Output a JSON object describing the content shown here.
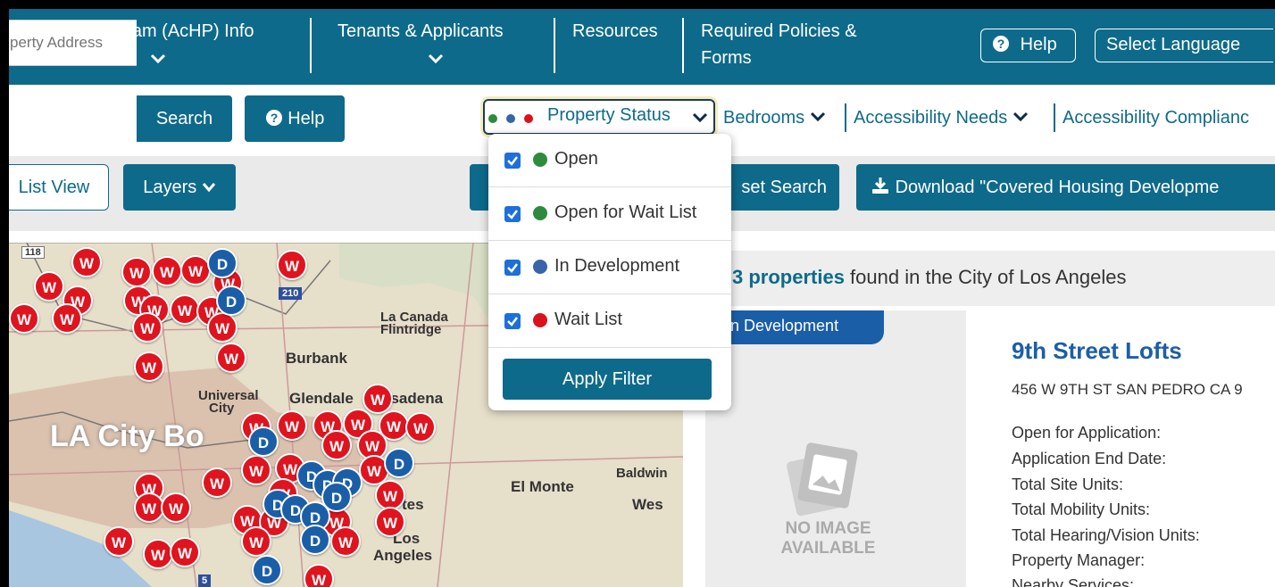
{
  "nav": {
    "items": [
      {
        "label": "Housing Program (AcHP) Info"
      },
      {
        "label": "Tenants & Applicants"
      },
      {
        "label": "Resources"
      },
      {
        "label": "Required Policies &"
      },
      {
        "label": "Forms"
      }
    ],
    "help_label": "Help",
    "language_label": "Select Language"
  },
  "search": {
    "placeholder": "perty Address",
    "search_label": "Search",
    "help_label": "Help"
  },
  "filters": {
    "property_status": "Property Status",
    "bedrooms": "Bedrooms",
    "accessibility_needs": "Accessibility Needs",
    "accessibility_compliance": "Accessibility Complianc"
  },
  "toolbar": {
    "list_view": "List View",
    "layers": "Layers",
    "reset_search": "set Search",
    "download": "Download \"Covered Housing Developme"
  },
  "dropdown": {
    "options": [
      {
        "label": "Open",
        "color": "#2e8b3e",
        "checked": true
      },
      {
        "label": "Open for Wait List",
        "color": "#2e8b3e",
        "checked": true
      },
      {
        "label": "In Development",
        "color": "#3a64a8",
        "checked": true
      },
      {
        "label": "Wait List",
        "color": "#d8121e",
        "checked": true
      }
    ],
    "apply_label": "Apply Filter"
  },
  "map": {
    "labels": {
      "la_canada": "La Canada",
      "flintridge": "Flintridge",
      "burbank": "Burbank",
      "universal": "Universal",
      "city": "City",
      "glendale": "Glendale",
      "pasadena": "asadena",
      "la_city_bo": "LA City Bo",
      "el_monte": "El Monte",
      "baldwin": "Baldwin",
      "west": "Wes",
      "los": "Los",
      "angeles": "Angeles",
      "tes": "tes",
      "hwy_118": "118",
      "hwy_210": "210",
      "hwy_5": "5"
    },
    "marker_w": "W",
    "marker_d": "D"
  },
  "results": {
    "count_bold": "3 properties",
    "count_rest": " found in the City of Los Angeles"
  },
  "card": {
    "status_tab": "n Development",
    "no_image_1": "NO IMAGE",
    "no_image_2": "AVAILABLE",
    "title": "9th Street Lofts",
    "address": "456 W 9TH ST SAN PEDRO CA 9",
    "fields": [
      "Open for Application:",
      "Application End Date:",
      "Total Site Units:",
      "Total Mobility Units:",
      "Total Hearing/Vision Units:",
      "Property Manager:",
      "Nearby Services:"
    ]
  }
}
